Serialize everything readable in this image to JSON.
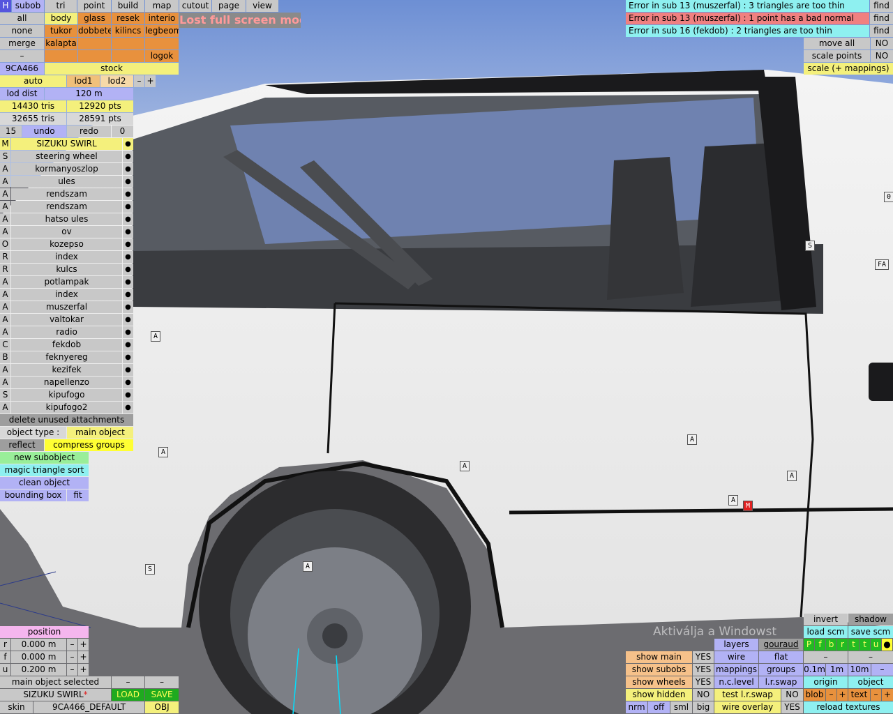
{
  "top_menu": {
    "h": "H",
    "items": [
      "subob",
      "tri",
      "point",
      "build",
      "map",
      "cutout",
      "page",
      "view"
    ]
  },
  "status_overlay": "Lost full screen mode",
  "select_rows": [
    [
      "all",
      "body",
      "glass",
      "resek",
      "interio"
    ],
    [
      "none",
      "tukor",
      "dobbete",
      "kilincs",
      "legbeom"
    ],
    [
      "merge",
      "kalapta",
      "",
      "",
      ""
    ],
    [
      "–",
      "",
      "",
      "",
      "logok"
    ]
  ],
  "object_id": "9CA466",
  "stock": "stock",
  "lod": {
    "auto": "auto",
    "lod1": "lod1",
    "lod2": "lod2",
    "minus": "–",
    "plus": "+",
    "dist_label": "lod dist",
    "dist_value": "120 m"
  },
  "stats": {
    "tris1": "14430 tris",
    "pts1": "12920 pts",
    "tris2": "32655 tris",
    "pts2": "28591 pts"
  },
  "undo": {
    "count": "15",
    "undo": "undo",
    "redo": "redo",
    "redo_count": "0"
  },
  "subobjects": [
    {
      "t": "M",
      "n": "SIZUKU SWIRL"
    },
    {
      "t": "S",
      "n": "steering wheel"
    },
    {
      "t": "A",
      "n": "kormanyoszlop"
    },
    {
      "t": "A",
      "n": "ules"
    },
    {
      "t": "A",
      "n": "rendszam"
    },
    {
      "t": "A",
      "n": "rendszam"
    },
    {
      "t": "A",
      "n": "hatso ules"
    },
    {
      "t": "A",
      "n": "ov"
    },
    {
      "t": "O",
      "n": "kozepso"
    },
    {
      "t": "R",
      "n": "index"
    },
    {
      "t": "R",
      "n": "kulcs"
    },
    {
      "t": "A",
      "n": "potlampak"
    },
    {
      "t": "A",
      "n": "index"
    },
    {
      "t": "A",
      "n": "muszerfal"
    },
    {
      "t": "A",
      "n": "valtokar"
    },
    {
      "t": "A",
      "n": "radio"
    },
    {
      "t": "C",
      "n": "fekdob"
    },
    {
      "t": "B",
      "n": "feknyereg"
    },
    {
      "t": "A",
      "n": "kezifek"
    },
    {
      "t": "A",
      "n": "napellenzo"
    },
    {
      "t": "S",
      "n": "kipufogo"
    },
    {
      "t": "A",
      "n": "kipufogo2"
    }
  ],
  "dot": "●",
  "left_actions": {
    "delete_unused": "delete unused attachments",
    "object_type_label": "object type :",
    "object_type_value": "main object",
    "reflect": "reflect",
    "compress": "compress groups",
    "new_sub": "new subobject",
    "magic": "magic triangle sort",
    "clean": "clean object",
    "bbox": "bounding box",
    "fit": "fit"
  },
  "position": {
    "title": "position",
    "rows": [
      {
        "axis": "r",
        "value": "0.000 m"
      },
      {
        "axis": "f",
        "value": "0.000 m"
      },
      {
        "axis": "u",
        "value": "0.200 m"
      }
    ],
    "minus": "–",
    "plus": "+"
  },
  "bottom_left": {
    "selected": "main object selected",
    "name": "SIZUKU SWIRL",
    "modified": "*",
    "load": "LOAD",
    "save": "SAVE",
    "skin_label": "skin",
    "skin_value": "9CA466_DEFAULT",
    "obj": "OBJ"
  },
  "errors": [
    {
      "text": "Error in sub 13 (muszerfal) : 3 triangles are too thin",
      "find": "find",
      "color": "#8ef0f0"
    },
    {
      "text": "Error in sub 13 (muszerfal) : 1 point has a bad normal",
      "find": "find",
      "color": "#f08080"
    },
    {
      "text": "Error in sub 16 (fekdob) : 2 triangles are too thin",
      "find": "find",
      "color": "#8ef0f0"
    }
  ],
  "right_top": {
    "move_all": "move all",
    "move_all_val": "NO",
    "scale_points": "scale points",
    "scale_points_val": "NO",
    "scale_map": "scale (+ mappings)"
  },
  "right_bottom": {
    "invert": "invert",
    "shadow": "shadow",
    "load_scm": "load scm",
    "save_scm": "save scm",
    "flags": [
      "P",
      "f",
      "b",
      "r",
      "t",
      "t",
      "u",
      "●"
    ],
    "layers": "layers",
    "gouraud": "gouraud",
    "flat": "flat",
    "show_main": "show main",
    "show_main_val": "YES",
    "wire": "wire",
    "show_subobs": "show subobs",
    "show_subobs_val": "YES",
    "mappings": "mappings",
    "groups": "groups",
    "show_wheels": "show wheels",
    "show_wheels_val": "YES",
    "nclevel": "n.c.level",
    "lrswap": "l.r.swap",
    "show_hidden": "show hidden",
    "show_hidden_val": "NO",
    "test_lr": "test l.r.swap",
    "test_lr_val": "NO",
    "nrm": "nrm",
    "off": "off",
    "sml": "sml",
    "big": "big",
    "wire_overlay": "wire overlay",
    "wire_overlay_val": "YES",
    "grid": [
      "0.1m",
      "1m",
      "10m",
      "–"
    ],
    "origin": "origin",
    "object": "object",
    "blob": "blob",
    "text": "text",
    "reload": "reload textures",
    "dash": "–",
    "plus": "+"
  },
  "tags": [
    "A",
    "A",
    "A",
    "A",
    "A",
    "A",
    "A",
    "S",
    "S",
    "M",
    "FA",
    "0"
  ],
  "watermark": "Aktiválja a Windowst"
}
